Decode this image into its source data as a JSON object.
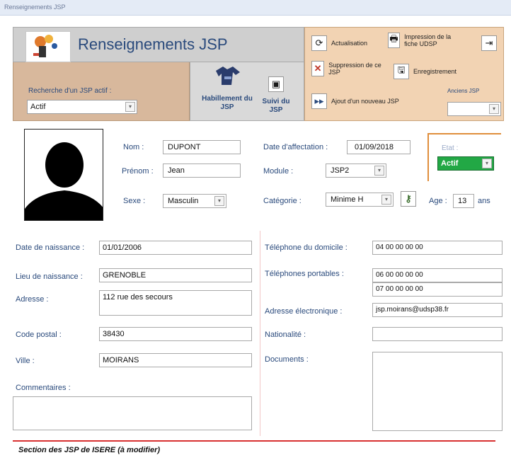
{
  "window": {
    "title": "Renseignements JSP"
  },
  "header": {
    "title": "Renseignements JSP",
    "search_label": "Recherche d'un JSP actif :",
    "search_value": "Actif",
    "habillement_label": "Habillement du JSP",
    "suivi_label": "Suivi du JSP"
  },
  "actions": {
    "actualisation": "Actualisation",
    "impression": "Impression de la fiche UDSP",
    "suppression": "Suppression de ce JSP",
    "enregistrement": "Enregistrement",
    "ajout": "Ajout d'un nouveau JSP",
    "anciens_label": "Anciens JSP",
    "anciens_value": ""
  },
  "identity": {
    "nom_label": "Nom :",
    "nom": "DUPONT",
    "prenom_label": "Prénom :",
    "prenom": "Jean",
    "sexe_label": "Sexe :",
    "sexe": "Masculin",
    "date_affectation_label": "Date d'affectation :",
    "date_affectation": "01/09/2018",
    "module_label": "Module :",
    "module": "JSP2",
    "categorie_label": "Catégorie :",
    "categorie": "Minime H",
    "age_label": "Age :",
    "age": "13",
    "age_unit": "ans",
    "etat_label": "Etat :",
    "etat": "Actif"
  },
  "details": {
    "naissance_label": "Date de naissance :",
    "naissance": "01/01/2006",
    "lieu_label": "Lieu de naissance :",
    "lieu": "GRENOBLE",
    "adresse_label": "Adresse :",
    "adresse": "112 rue des secours",
    "cp_label": "Code postal :",
    "cp": "38430",
    "ville_label": "Ville :",
    "ville": "MOIRANS",
    "commentaires_label": "Commentaires :",
    "commentaires": "",
    "tel_dom_label": "Téléphone du domicile :",
    "tel_dom": "04 00 00 00 00",
    "tel_port_label": "Téléphones portables :",
    "tel_port_1": "06 00 00 00 00",
    "tel_port_2": "07 00 00 00 00",
    "email_label": "Adresse électronique :",
    "email": "jsp.moirans@udsp38.fr",
    "nationalite_label": "Nationalité :",
    "nationalite": "",
    "documents_label": "Documents :"
  },
  "footer": {
    "section": "Section des JSP de ISERE (à modifier)"
  },
  "colors": {
    "accent": "#2a4a7c",
    "etat_green": "#22a845",
    "footer_red": "#d83030"
  }
}
